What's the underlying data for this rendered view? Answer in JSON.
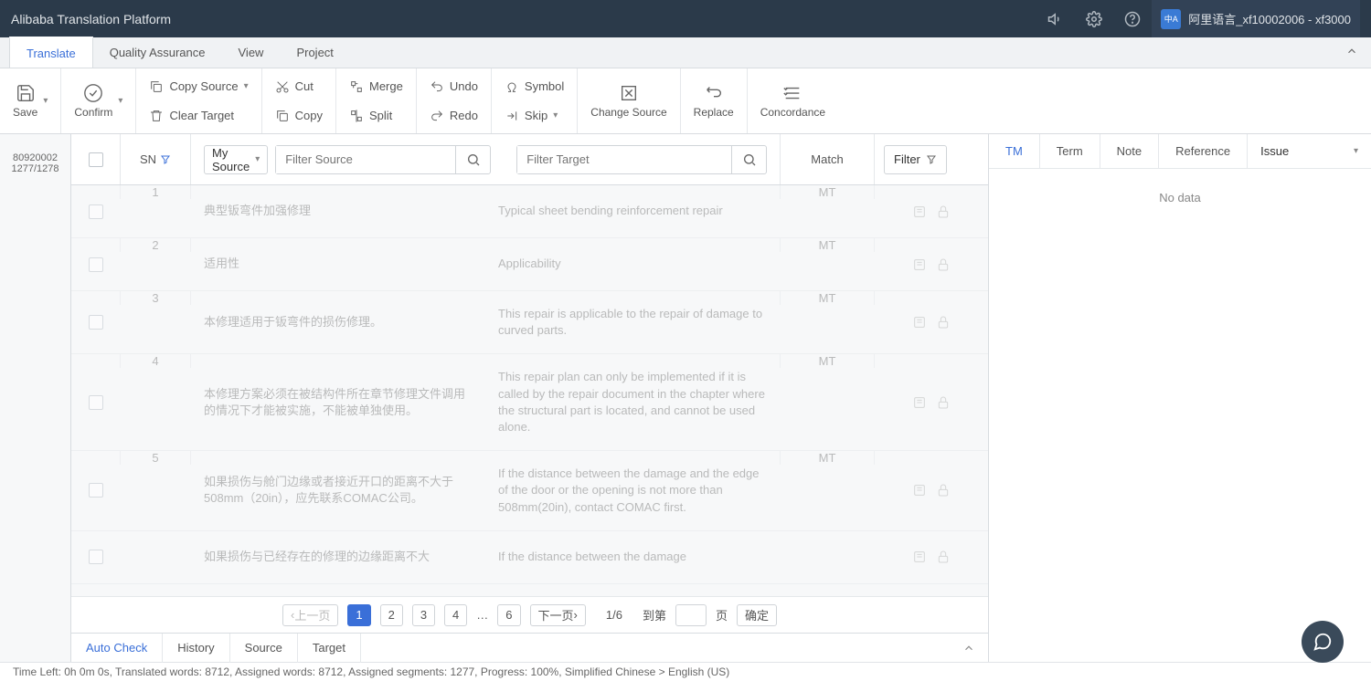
{
  "app_title": "Alibaba Translation Platform",
  "user_label": "阿里语言_xf10002006 - xf3000",
  "menus": {
    "translate": "Translate",
    "qa": "Quality Assurance",
    "view": "View",
    "project": "Project"
  },
  "toolbar": {
    "save": "Save",
    "confirm": "Confirm",
    "copy_source": "Copy Source",
    "clear_target": "Clear Target",
    "cut": "Cut",
    "copy": "Copy",
    "merge": "Merge",
    "split": "Split",
    "undo": "Undo",
    "redo": "Redo",
    "symbol": "Symbol",
    "skip": "Skip",
    "change_source": "Change Source",
    "replace": "Replace",
    "concordance": "Concordance"
  },
  "left_rail": {
    "id": "80920002",
    "counts": "1277/1278"
  },
  "grid": {
    "sn": "SN",
    "my_source": "My Source",
    "filter_source_ph": "Filter Source",
    "filter_target_ph": "Filter Target",
    "match": "Match",
    "filter": "Filter"
  },
  "rows": [
    {
      "sn": "1",
      "source": "典型钣弯件加强修理",
      "target": "Typical sheet bending reinforcement repair",
      "match": "MT"
    },
    {
      "sn": "2",
      "source": "适用性",
      "target": "Applicability",
      "match": "MT"
    },
    {
      "sn": "3",
      "source": "本修理适用于钣弯件的损伤修理。",
      "target": "This repair is applicable to the repair of damage to curved parts.",
      "match": "MT"
    },
    {
      "sn": "4",
      "source": "本修理方案必须在被结构件所在章节修理文件调用的情况下才能被实施，不能被单独使用。",
      "target": "This repair plan can only be implemented if it is called by the repair document in the chapter where the structural part is located, and cannot be used alone.",
      "match": "MT"
    },
    {
      "sn": "5",
      "source": "如果损伤与舱门边缘或者接近开口的距离不大于508mm（20in），应先联系COMAC公司。",
      "target": "If the distance between the damage and the edge of the door or the opening is not more than 508mm(20in), contact COMAC first.",
      "match": "MT"
    },
    {
      "sn": "",
      "source": "如果损伤与已经存在的修理的边缘距离不大",
      "target": "If the distance between the damage",
      "match": ""
    }
  ],
  "pagination": {
    "prev": "上一页",
    "pages": [
      "1",
      "2",
      "3",
      "4"
    ],
    "ellipsis": "…",
    "last": "6",
    "next": "下一页",
    "indicator": "1/6",
    "to_label": "到第",
    "page_label": "页",
    "go": "确定"
  },
  "bottom_tabs": {
    "auto": "Auto Check",
    "history": "History",
    "source": "Source",
    "target": "Target"
  },
  "right_pane": {
    "tm": "TM",
    "term": "Term",
    "note": "Note",
    "reference": "Reference",
    "issue": "Issue",
    "no_data": "No data"
  },
  "status": "Time Left: 0h 0m 0s, Translated words: 8712, Assigned words: 8712, Assigned segments: 1277, Progress: 100%, Simplified Chinese > English (US)"
}
